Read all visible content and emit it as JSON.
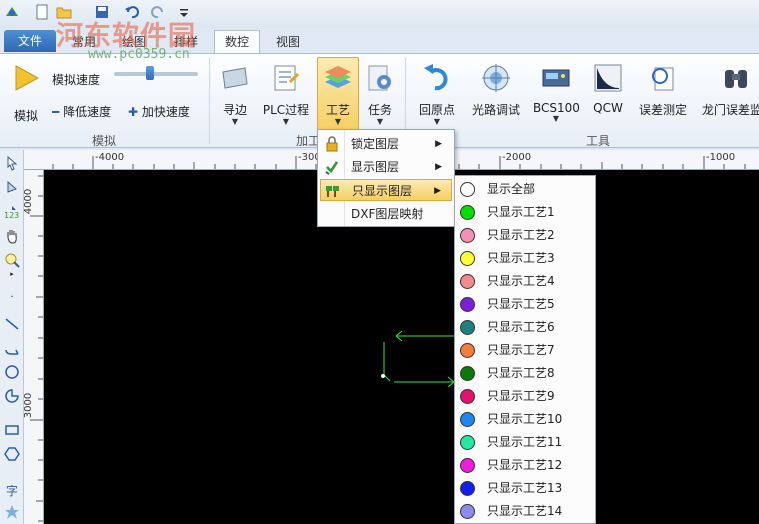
{
  "watermark": {
    "text": "河东软件园",
    "url": "www.pc0359.cn"
  },
  "tabs": {
    "file": "文件",
    "common": "常用",
    "draw": "绘图",
    "arrange": "排样",
    "nc": "数控",
    "view": "视图"
  },
  "ribbon": {
    "simulate": "模拟",
    "sim_speed": "模拟速度",
    "slow_down": "降低速度",
    "speed_up": "加快速度",
    "group_sim": "模拟",
    "edge": "寻边",
    "plc": "PLC过程",
    "process": "工艺",
    "task": "任务",
    "group_process": "加工",
    "origin": "回原点",
    "optical": "光路调试",
    "bcs": "BCS100",
    "qcw": "QCW",
    "error_measure": "误差测定",
    "gantry_error": "龙门误差监",
    "group_tools": "工具"
  },
  "rulers": {
    "h": [
      "-4000",
      "-300",
      "-2000",
      "-1000"
    ],
    "v": [
      "4000",
      "3000"
    ]
  },
  "menu1": {
    "lock_layer": "锁定图层",
    "show_layer": "显示图层",
    "only_show_layer": "只显示图层",
    "dxf_map": "DXF图层映射"
  },
  "menu2": {
    "items": [
      {
        "label": "显示全部",
        "color": "#ffffff"
      },
      {
        "label": "只显示工艺1",
        "color": "#00e000"
      },
      {
        "label": "只显示工艺2",
        "color": "#f48fb8"
      },
      {
        "label": "只显示工艺3",
        "color": "#ffff33"
      },
      {
        "label": "只显示工艺4",
        "color": "#f58a8a"
      },
      {
        "label": "只显示工艺5",
        "color": "#7c1fd8"
      },
      {
        "label": "只显示工艺6",
        "color": "#1e8080"
      },
      {
        "label": "只显示工艺7",
        "color": "#f57c3a"
      },
      {
        "label": "只显示工艺8",
        "color": "#0a7a0a"
      },
      {
        "label": "只显示工艺9",
        "color": "#e8106e"
      },
      {
        "label": "只显示工艺10",
        "color": "#1c86f0"
      },
      {
        "label": "只显示工艺11",
        "color": "#22e8a0"
      },
      {
        "label": "只显示工艺12",
        "color": "#f01ae0"
      },
      {
        "label": "只显示工艺13",
        "color": "#1020e8"
      },
      {
        "label": "只显示工艺14",
        "color": "#8c8cf0"
      }
    ]
  }
}
